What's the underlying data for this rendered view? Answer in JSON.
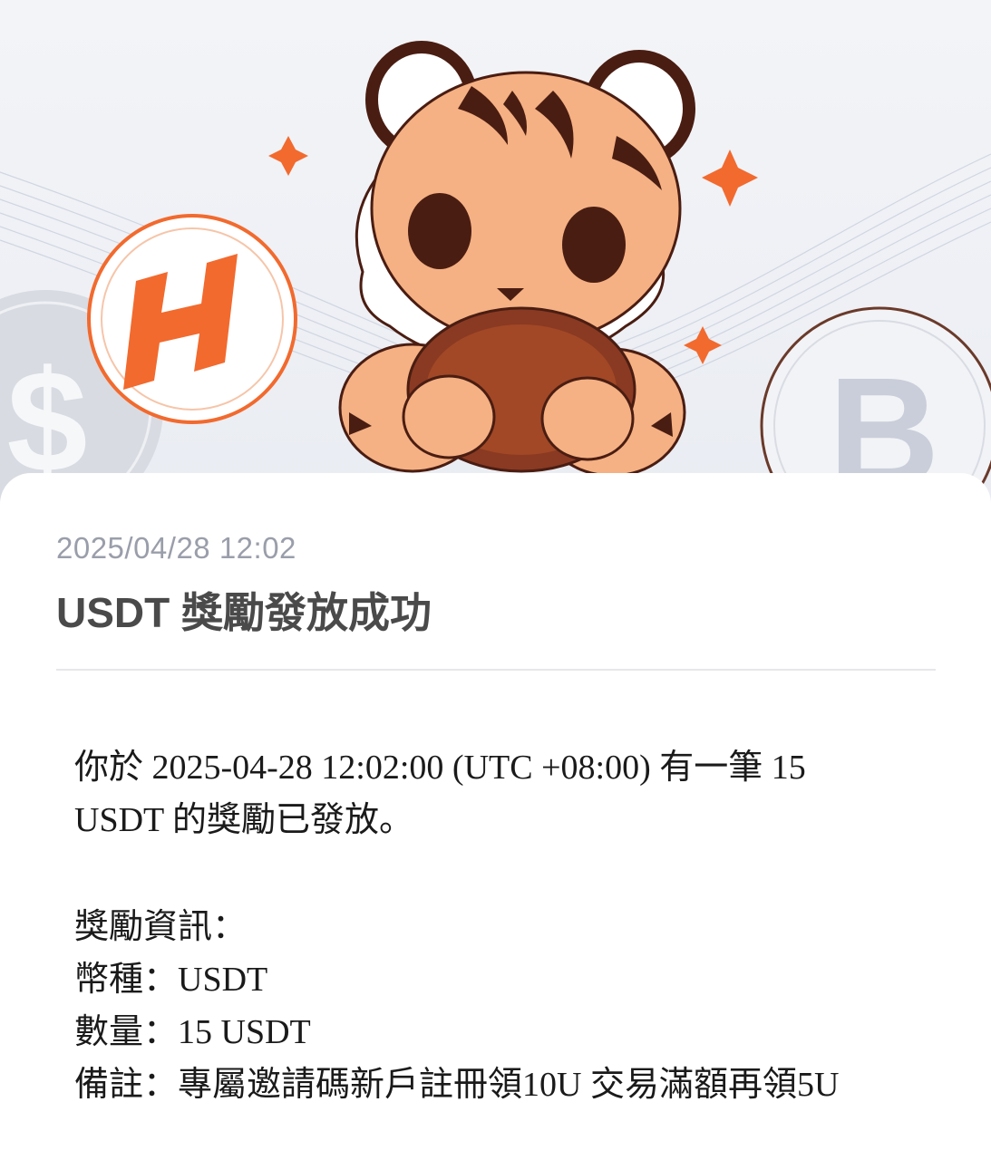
{
  "notice": {
    "timestamp": "2025/04/28 12:02",
    "title": "USDT 獎勵發放成功",
    "message_line1": "你於 2025-04-28 12:02:00 (UTC +08:00) 有一筆 15",
    "message_line2": "USDT 的獎勵已發放。",
    "details_heading": "獎勵資訊：",
    "currency_line": "幣種：USDT",
    "amount_line": "數量：15 USDT",
    "remark_line": "備註：專屬邀請碼新戶註冊領10U 交易滿額再領5U"
  },
  "banner": {
    "logo_letter": "H",
    "left_coin_symbol": "$",
    "right_coin_symbol": "B",
    "accent_color": "#f26a2e",
    "tiger_fur_color": "#f5b183",
    "tiger_stripe_color": "#4a1d12"
  }
}
